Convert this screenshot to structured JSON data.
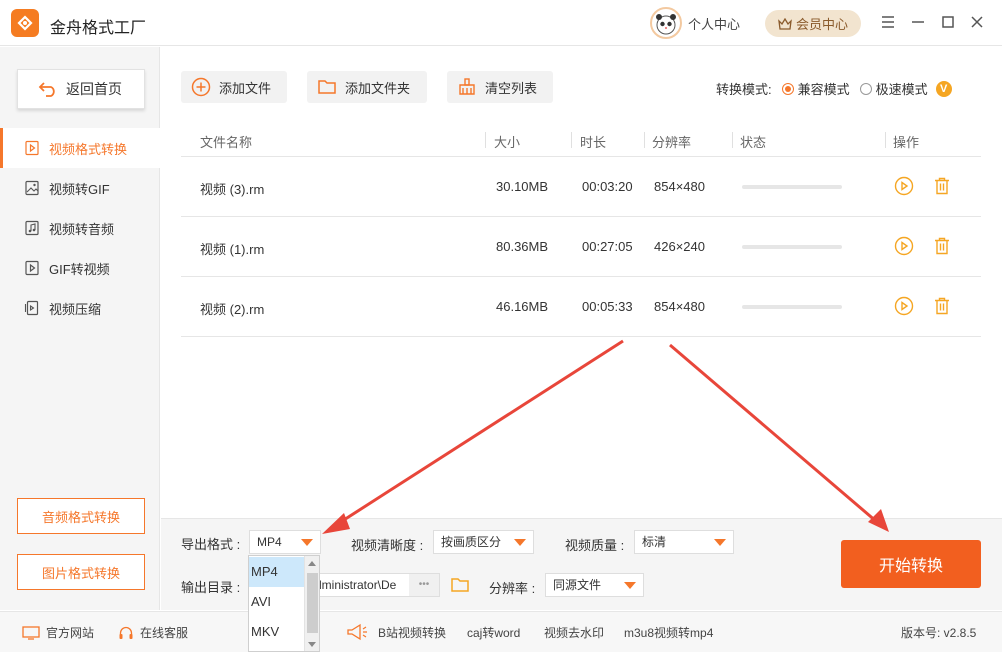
{
  "app": {
    "title": "金舟格式工厂"
  },
  "header": {
    "personal_center": "个人中心",
    "vip_center": "会员中心"
  },
  "sidebar": {
    "back_label": "返回首页",
    "items": [
      {
        "label": "视频格式转换",
        "icon": "video-convert-icon",
        "active": true
      },
      {
        "label": "视频转GIF",
        "icon": "image-icon",
        "active": false
      },
      {
        "label": "视频转音频",
        "icon": "music-icon",
        "active": false
      },
      {
        "label": "GIF转视频",
        "icon": "play-icon",
        "active": false
      },
      {
        "label": "视频压缩",
        "icon": "compress-icon",
        "active": false
      }
    ],
    "audio_convert": "音频格式转换",
    "image_convert": "图片格式转换"
  },
  "toolbar": {
    "add_file": "添加文件",
    "add_folder": "添加文件夹",
    "clear_list": "清空列表"
  },
  "mode": {
    "label": "转换模式:",
    "compatible": "兼容模式",
    "fast": "极速模式",
    "selected": "compatible",
    "vip_badge": "V"
  },
  "table": {
    "headers": {
      "name": "文件名称",
      "size": "大小",
      "duration": "时长",
      "resolution": "分辨率",
      "status": "状态",
      "action": "操作"
    },
    "rows": [
      {
        "name": "视频 (3).rm",
        "size": "30.10MB",
        "duration": "00:03:20",
        "resolution": "854×480",
        "progress": 0
      },
      {
        "name": "视频 (1).rm",
        "size": "80.36MB",
        "duration": "00:27:05",
        "resolution": "426×240",
        "progress": 0
      },
      {
        "name": "视频 (2).rm",
        "size": "46.16MB",
        "duration": "00:05:33",
        "resolution": "854×480",
        "progress": 0
      }
    ]
  },
  "settings": {
    "export_format_label": "导出格式 :",
    "export_format_value": "MP4",
    "clarity_label": "视频清晰度 :",
    "clarity_value": "按画质区分",
    "quality_label": "视频质量 :",
    "quality_value": "标清",
    "output_dir_label": "输出目录 :",
    "output_dir_value": "dministrator\\De",
    "output_dir_more": "•••",
    "resolution_label": "分辨率 :",
    "resolution_value": "同源文件"
  },
  "format_dropdown": {
    "options": [
      "MP4",
      "AVI",
      "MKV"
    ],
    "selected": "MP4"
  },
  "start_button": "开始转换",
  "footer": {
    "official_site": "官方网站",
    "online_service": "在线客服",
    "links": [
      "B站视频转换",
      "caj转word",
      "视频去水印",
      "m3u8视频转mp4"
    ],
    "version": "版本号: v2.8.5"
  },
  "colors": {
    "accent": "#f5772b",
    "start_button": "#f25f1f",
    "arrow": "#e8463a"
  }
}
